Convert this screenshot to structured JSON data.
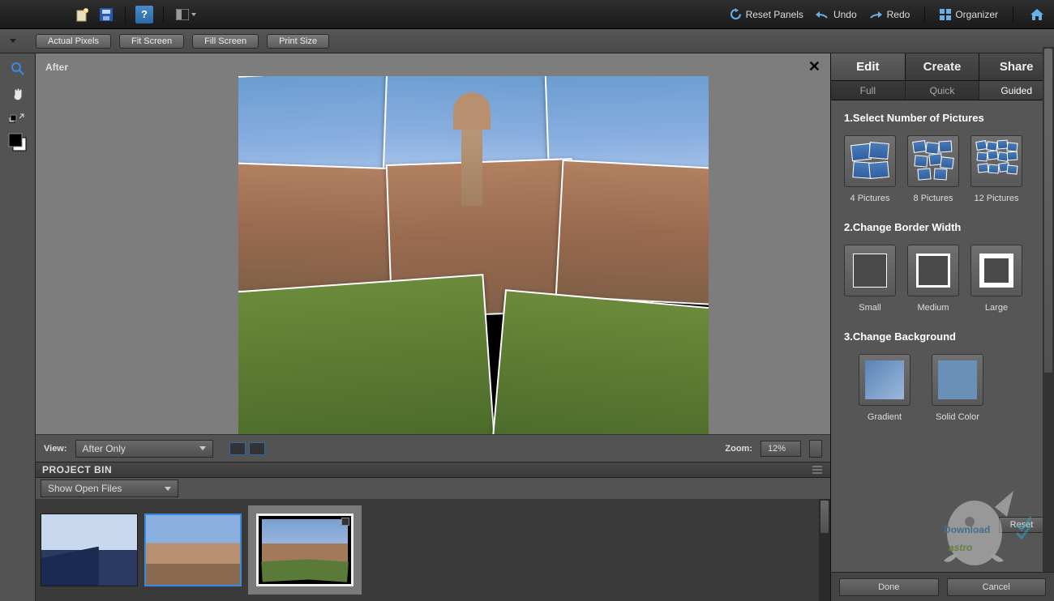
{
  "top": {
    "reset_panels": "Reset Panels",
    "undo": "Undo",
    "redo": "Redo",
    "organizer": "Organizer"
  },
  "options": {
    "actual_pixels": "Actual Pixels",
    "fit_screen": "Fit Screen",
    "fill_screen": "Fill Screen",
    "print_size": "Print Size"
  },
  "canvas": {
    "after_label": "After",
    "view_label": "View:",
    "view_option": "After Only",
    "zoom_label": "Zoom:",
    "zoom_value": "12%"
  },
  "bin": {
    "title": "PROJECT BIN",
    "filter": "Show Open Files"
  },
  "right": {
    "tabs": {
      "edit": "Edit",
      "create": "Create",
      "share": "Share"
    },
    "subtabs": {
      "full": "Full",
      "quick": "Quick",
      "guided": "Guided"
    },
    "s1": {
      "title": "1.Select Number of Pictures",
      "p4": "4 Pictures",
      "p8": "8 Pictures",
      "p12": "12 Pictures"
    },
    "s2": {
      "title": "2.Change Border Width",
      "small": "Small",
      "medium": "Medium",
      "large": "Large"
    },
    "s3": {
      "title": "3.Change Background",
      "gradient": "Gradient",
      "solid": "Solid Color"
    },
    "reset": "Reset",
    "done": "Done",
    "cancel": "Cancel"
  },
  "watermark": {
    "download": "Download",
    "brand": "astro"
  }
}
